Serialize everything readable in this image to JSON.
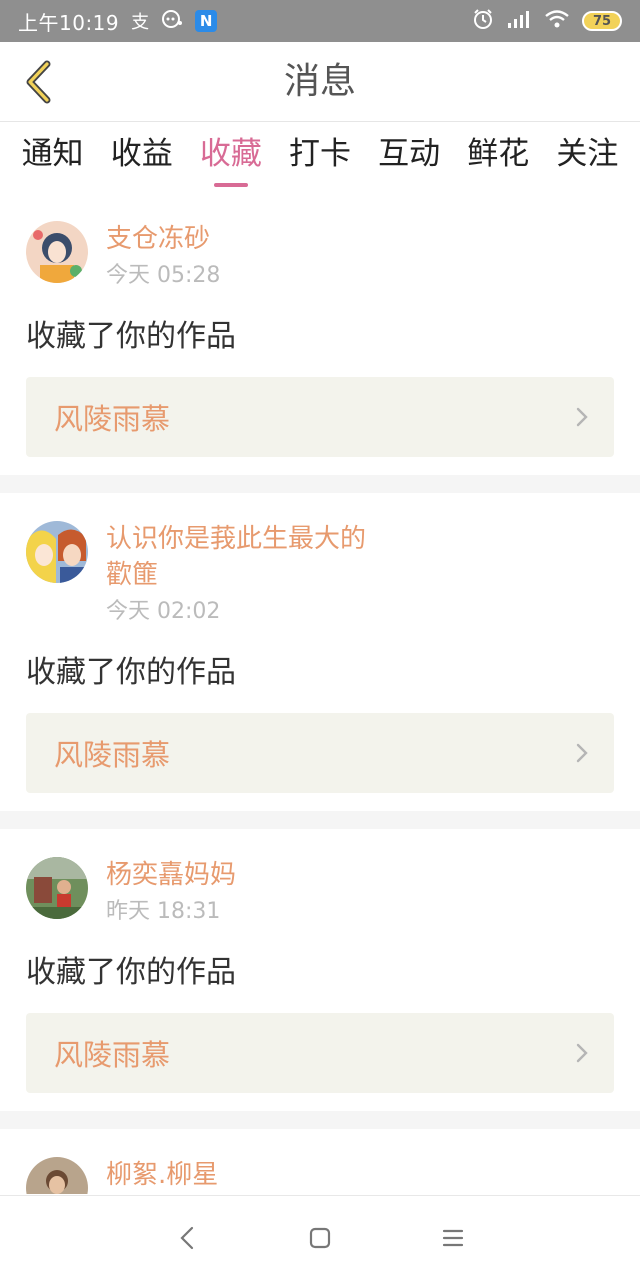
{
  "status_bar": {
    "time": "上午10:19",
    "battery": "75",
    "left_icons": [
      "alipay-icon",
      "chat-icon",
      "n-app-icon"
    ],
    "right_icons": [
      "alarm-icon",
      "signal-icon",
      "wifi-icon",
      "battery-icon"
    ],
    "n_badge": "N",
    "alipay_glyph": "支"
  },
  "header": {
    "title": "消息",
    "back_icon": "chevron-left-icon"
  },
  "tabs": [
    {
      "label": "通知",
      "active": false
    },
    {
      "label": "收益",
      "active": false
    },
    {
      "label": "收藏",
      "active": true
    },
    {
      "label": "打卡",
      "active": false
    },
    {
      "label": "互动",
      "active": false
    },
    {
      "label": "鲜花",
      "active": false
    },
    {
      "label": "关注",
      "active": false
    }
  ],
  "messages": [
    {
      "username": "支仓冻砂",
      "time": "今天 05:28",
      "action": "收藏了你的作品",
      "work_title": "风陵雨慕"
    },
    {
      "username": "认识你是莪此生最大的\n歡篚",
      "time": "今天 02:02",
      "action": "收藏了你的作品",
      "work_title": "风陵雨慕"
    },
    {
      "username": "杨奕嚞妈妈",
      "time": "昨天 18:31",
      "action": "收藏了你的作品",
      "work_title": "风陵雨慕"
    },
    {
      "username": "柳絮.柳星",
      "time": "",
      "action": "",
      "work_title": ""
    }
  ],
  "colors": {
    "accent_pink": "#d86b95",
    "name_orange": "#e79a6e",
    "status_bar_bg": "#8f8f8f",
    "work_box_bg": "#f3f3ec"
  },
  "nav_bar": {
    "icons": [
      "back-nav-icon",
      "home-nav-icon",
      "menu-nav-icon"
    ]
  }
}
